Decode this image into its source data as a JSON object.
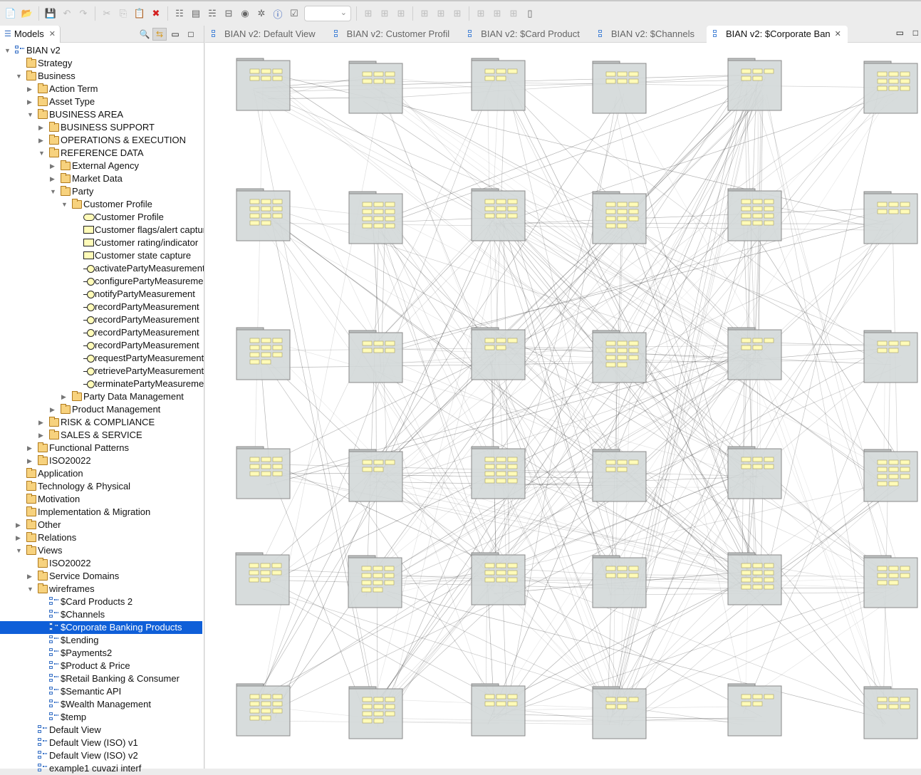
{
  "toolbar": {
    "items": [
      "new-icon",
      "open-icon",
      "save-icon",
      "undo-icon",
      "redo-icon",
      "cut-icon",
      "copy-icon",
      "paste-icon",
      "delete-icon",
      "model-tree-icon",
      "properties-icon",
      "outline-icon",
      "navigator-icon",
      "palette-icon",
      "visualiser-icon",
      "info-icon",
      "validate-icon"
    ],
    "zoom_value": ""
  },
  "models_panel": {
    "title": "Models"
  },
  "tree": [
    {
      "l": 0,
      "a": "open",
      "i": "model",
      "t": "BIAN v2"
    },
    {
      "l": 1,
      "a": "",
      "i": "folder",
      "t": "Strategy"
    },
    {
      "l": 1,
      "a": "open",
      "i": "folder",
      "t": "Business"
    },
    {
      "l": 2,
      "a": "closed",
      "i": "folder",
      "t": "Action Term"
    },
    {
      "l": 2,
      "a": "closed",
      "i": "folder",
      "t": "Asset Type"
    },
    {
      "l": 2,
      "a": "open",
      "i": "folder",
      "t": "BUSINESS AREA"
    },
    {
      "l": 3,
      "a": "closed",
      "i": "folder",
      "t": "BUSINESS SUPPORT"
    },
    {
      "l": 3,
      "a": "closed",
      "i": "folder",
      "t": "OPERATIONS & EXECUTION"
    },
    {
      "l": 3,
      "a": "open",
      "i": "folder",
      "t": "REFERENCE DATA"
    },
    {
      "l": 4,
      "a": "closed",
      "i": "folder",
      "t": "External Agency"
    },
    {
      "l": 4,
      "a": "closed",
      "i": "folder",
      "t": "Market Data"
    },
    {
      "l": 4,
      "a": "open",
      "i": "folder",
      "t": "Party"
    },
    {
      "l": 5,
      "a": "open",
      "i": "folder",
      "t": "Customer Profile"
    },
    {
      "l": 6,
      "a": "",
      "i": "oval",
      "t": "Customer Profile"
    },
    {
      "l": 6,
      "a": "",
      "i": "note",
      "t": "Customer flags/alert capture"
    },
    {
      "l": 6,
      "a": "",
      "i": "note",
      "t": "Customer rating/indicator"
    },
    {
      "l": 6,
      "a": "",
      "i": "note",
      "t": "Customer state capture"
    },
    {
      "l": 6,
      "a": "",
      "i": "iface",
      "t": "activatePartyMeasurement"
    },
    {
      "l": 6,
      "a": "",
      "i": "iface",
      "t": "configurePartyMeasurement"
    },
    {
      "l": 6,
      "a": "",
      "i": "iface",
      "t": "notifyPartyMeasurement"
    },
    {
      "l": 6,
      "a": "",
      "i": "iface",
      "t": "recordPartyMeasurement"
    },
    {
      "l": 6,
      "a": "",
      "i": "iface",
      "t": "recordPartyMeasurement"
    },
    {
      "l": 6,
      "a": "",
      "i": "iface",
      "t": "recordPartyMeasurement"
    },
    {
      "l": 6,
      "a": "",
      "i": "iface",
      "t": "recordPartyMeasurement"
    },
    {
      "l": 6,
      "a": "",
      "i": "iface",
      "t": "requestPartyMeasurement"
    },
    {
      "l": 6,
      "a": "",
      "i": "iface",
      "t": "retrievePartyMeasurement"
    },
    {
      "l": 6,
      "a": "",
      "i": "iface",
      "t": "terminatePartyMeasurement"
    },
    {
      "l": 5,
      "a": "closed",
      "i": "folder",
      "t": "Party Data Management"
    },
    {
      "l": 4,
      "a": "closed",
      "i": "folder",
      "t": "Product Management"
    },
    {
      "l": 3,
      "a": "closed",
      "i": "folder",
      "t": "RISK & COMPLIANCE"
    },
    {
      "l": 3,
      "a": "closed",
      "i": "folder",
      "t": "SALES & SERVICE"
    },
    {
      "l": 2,
      "a": "closed",
      "i": "folder",
      "t": "Functional Patterns"
    },
    {
      "l": 2,
      "a": "closed",
      "i": "folder",
      "t": "ISO20022"
    },
    {
      "l": 1,
      "a": "",
      "i": "folder",
      "t": "Application"
    },
    {
      "l": 1,
      "a": "",
      "i": "folder",
      "t": "Technology & Physical"
    },
    {
      "l": 1,
      "a": "",
      "i": "folder",
      "t": "Motivation"
    },
    {
      "l": 1,
      "a": "",
      "i": "folder",
      "t": "Implementation & Migration"
    },
    {
      "l": 1,
      "a": "closed",
      "i": "folder",
      "t": "Other"
    },
    {
      "l": 1,
      "a": "closed",
      "i": "folder",
      "t": "Relations"
    },
    {
      "l": 1,
      "a": "open",
      "i": "folder",
      "t": "Views"
    },
    {
      "l": 2,
      "a": "",
      "i": "folder",
      "t": "ISO20022"
    },
    {
      "l": 2,
      "a": "closed",
      "i": "folder",
      "t": "Service Domains"
    },
    {
      "l": 2,
      "a": "open",
      "i": "folder",
      "t": "wireframes"
    },
    {
      "l": 3,
      "a": "",
      "i": "view",
      "t": "$Card Products 2"
    },
    {
      "l": 3,
      "a": "",
      "i": "view",
      "t": "$Channels"
    },
    {
      "l": 3,
      "a": "",
      "i": "view",
      "t": "$Corporate Banking Products",
      "sel": true
    },
    {
      "l": 3,
      "a": "",
      "i": "view",
      "t": "$Lending"
    },
    {
      "l": 3,
      "a": "",
      "i": "view",
      "t": "$Payments2"
    },
    {
      "l": 3,
      "a": "",
      "i": "view",
      "t": "$Product & Price"
    },
    {
      "l": 3,
      "a": "",
      "i": "view",
      "t": "$Retail Banking & Consumer"
    },
    {
      "l": 3,
      "a": "",
      "i": "view",
      "t": "$Semantic API"
    },
    {
      "l": 3,
      "a": "",
      "i": "view",
      "t": "$Wealth Management"
    },
    {
      "l": 3,
      "a": "",
      "i": "view",
      "t": "$temp"
    },
    {
      "l": 2,
      "a": "",
      "i": "view",
      "t": "Default View"
    },
    {
      "l": 2,
      "a": "",
      "i": "view",
      "t": "Default View (ISO) v1"
    },
    {
      "l": 2,
      "a": "",
      "i": "view",
      "t": "Default View (ISO) v2"
    },
    {
      "l": 2,
      "a": "",
      "i": "view",
      "t": "example1 cuvazi interf"
    }
  ],
  "editor_tabs": [
    {
      "label": "BIAN v2: Default View"
    },
    {
      "label": "BIAN v2: Customer Profil"
    },
    {
      "label": "BIAN v2: $Card Product"
    },
    {
      "label": "BIAN v2: $Channels"
    },
    {
      "label": "BIAN v2: $Corporate Ban",
      "active": true
    }
  ],
  "colors": {
    "selection": "#0f5fd8",
    "group_fill": "#d3d8d8",
    "element_fill": "#fffbb8"
  }
}
